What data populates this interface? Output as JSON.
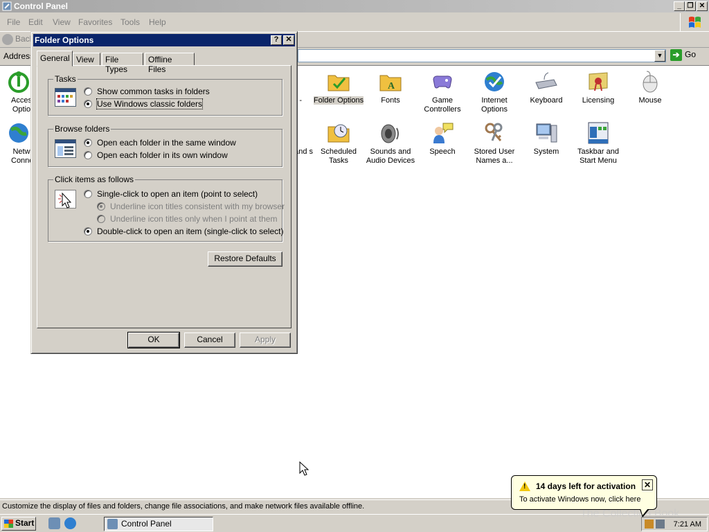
{
  "window": {
    "title": "Control Panel",
    "menu": [
      "File",
      "Edit",
      "View",
      "Favorites",
      "Tools",
      "Help"
    ],
    "back_label": "Back",
    "address_label": "Address",
    "go_label": "Go",
    "status_text": "Customize the display of files and folders, change file associations, and make network files available offline."
  },
  "left_items": [
    {
      "label": "Access Optio",
      "icon": "accessibility-icon",
      "color": "#2a9d2a"
    },
    {
      "label": "Netw Conne",
      "icon": "network-globe-icon",
      "color": "#2f7fd0"
    }
  ],
  "partial_items": [
    {
      "label": "",
      "icon": "partial-icon"
    },
    {
      "label": "and s",
      "icon": "partial-icon"
    }
  ],
  "cp_items": [
    {
      "label": "Folder Options",
      "icon": "folder-options-icon",
      "color": "#f0c040",
      "selected": true
    },
    {
      "label": "Fonts",
      "icon": "fonts-folder-icon",
      "color": "#f0c040"
    },
    {
      "label": "Game Controllers",
      "icon": "game-controller-icon",
      "color": "#8a7ad8"
    },
    {
      "label": "Internet Options",
      "icon": "internet-globe-icon",
      "color": "#2f7fd0"
    },
    {
      "label": "Keyboard",
      "icon": "keyboard-icon",
      "color": "#b8bcc8"
    },
    {
      "label": "Licensing",
      "icon": "licensing-certificate-icon",
      "color": "#e8d070"
    },
    {
      "label": "Mouse",
      "icon": "mouse-icon",
      "color": "#d8d8d8"
    },
    {
      "label": "Scheduled Tasks",
      "icon": "scheduled-tasks-icon",
      "color": "#f0c040"
    },
    {
      "label": "Sounds and Audio Devices",
      "icon": "speaker-icon",
      "color": "#8a8a8a"
    },
    {
      "label": "Speech",
      "icon": "speech-icon",
      "color": "#d07030"
    },
    {
      "label": "Stored User Names a...",
      "icon": "keys-icon",
      "color": "#a07850"
    },
    {
      "label": "System",
      "icon": "system-computer-icon",
      "color": "#6d8fb5"
    },
    {
      "label": "Taskbar and Start Menu",
      "icon": "taskbar-icon",
      "color": "#2f6fb8"
    }
  ],
  "dialog": {
    "title": "Folder Options",
    "help_btn": "?",
    "close_btn": "✕",
    "tabs": [
      "General",
      "View",
      "File Types",
      "Offline Files"
    ],
    "active_tab": "General",
    "tasks": {
      "title": "Tasks",
      "options": [
        "Show common tasks in folders",
        "Use Windows classic folders"
      ],
      "selected": 1
    },
    "browse": {
      "title": "Browse folders",
      "options": [
        "Open each folder in the same window",
        "Open each folder in its own window"
      ],
      "selected": 0
    },
    "click": {
      "title": "Click items as follows",
      "single": "Single-click to open an item (point to select)",
      "sub1": "Underline icon titles consistent with my browser",
      "sub2": "Underline icon titles only when I point at them",
      "double": "Double-click to open an item (single-click to select)",
      "selected": "double"
    },
    "restore_btn": "Restore Defaults",
    "ok_btn": "OK",
    "cancel_btn": "Cancel",
    "apply_btn": "Apply"
  },
  "balloon": {
    "title": "14 days left for activation",
    "text": "To activate Windows now, click here"
  },
  "taskbar": {
    "start_label": "Start",
    "task_label": "Control Panel",
    "clock": "7:21 AM"
  },
  "watermark": "The Collection Book"
}
